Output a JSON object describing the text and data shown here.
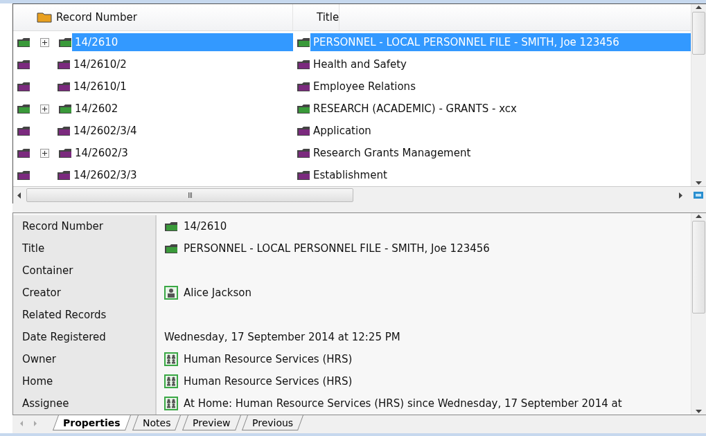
{
  "grid": {
    "columns": [
      "Record Number",
      "Title"
    ],
    "rows": [
      {
        "number": "14/2610",
        "title": "PERSONNEL - LOCAL PERSONNEL FILE - SMITH, Joe 123456",
        "color": "#3a9a3a",
        "expandable": true,
        "selected": true
      },
      {
        "number": "14/2610/2",
        "title": "Health and Safety",
        "color": "#7b2a7e",
        "expandable": false,
        "selected": false
      },
      {
        "number": "14/2610/1",
        "title": "Employee Relations",
        "color": "#7b2a7e",
        "expandable": false,
        "selected": false
      },
      {
        "number": "14/2602",
        "title": "RESEARCH (ACADEMIC) - GRANTS - xcx",
        "color": "#3a9a3a",
        "expandable": true,
        "selected": false
      },
      {
        "number": "14/2602/3/4",
        "title": "Application",
        "color": "#7b2a7e",
        "expandable": false,
        "selected": false
      },
      {
        "number": "14/2602/3",
        "title": "Research Grants Management",
        "color": "#7b2a7e",
        "expandable": true,
        "selected": false
      },
      {
        "number": "14/2602/3/3",
        "title": "Establishment",
        "color": "#7b2a7e",
        "expandable": false,
        "selected": false
      }
    ],
    "hscroll_grip": "III"
  },
  "properties": [
    {
      "label": "Record Number",
      "value": "14/2610",
      "kind": "folder"
    },
    {
      "label": "Title",
      "value": "PERSONNEL - LOCAL PERSONNEL FILE - SMITH, Joe 123456",
      "kind": "folder"
    },
    {
      "label": "Container"
    },
    {
      "label": "Creator",
      "value": "Alice Jackson",
      "kind": "person"
    },
    {
      "label": "Related Records"
    },
    {
      "label": "Date Registered",
      "value": "Wednesday, 17 September 2014 at 12:25 PM"
    },
    {
      "label": "Owner",
      "value": "Human Resource Services (HRS)",
      "kind": "group"
    },
    {
      "label": "Home",
      "value": "Human Resource Services (HRS)",
      "kind": "group"
    },
    {
      "label": "Assignee",
      "value": "At Home: Human Resource Services (HRS) since Wednesday, 17 September 2014 at",
      "kind": "group"
    }
  ],
  "tabs": [
    {
      "label": "Properties",
      "selected": true
    },
    {
      "label": "Notes",
      "selected": false
    },
    {
      "label": "Preview",
      "selected": false
    },
    {
      "label": "Previous",
      "selected": false
    }
  ]
}
